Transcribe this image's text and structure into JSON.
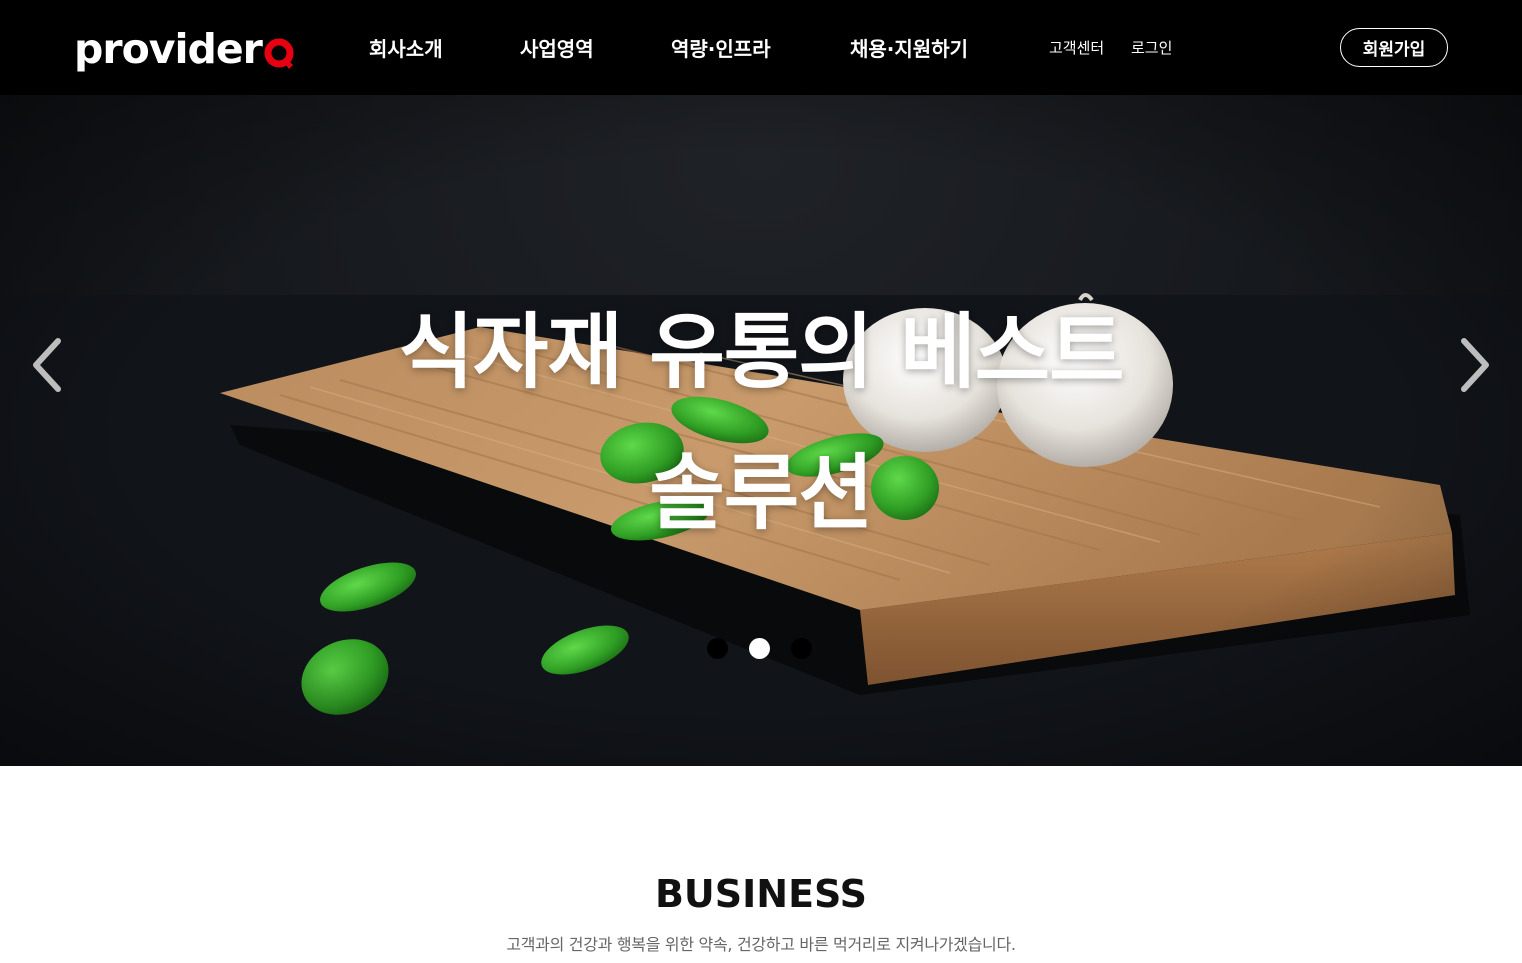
{
  "header": {
    "logo_text": "provider",
    "logo_q_letter": "Q",
    "nav": [
      {
        "label": "회사소개"
      },
      {
        "label": "사업영역"
      },
      {
        "label": "역량·인프라"
      },
      {
        "label": "채용·지원하기"
      }
    ],
    "util": [
      {
        "label": "고객센터"
      },
      {
        "label": "로그인"
      }
    ],
    "signup_label": "회원가입"
  },
  "hero": {
    "title_line1": "식자재 유통의 베스트",
    "title_line2": "솔루션",
    "active_slide": 1,
    "slide_count": 3
  },
  "business": {
    "title": "BUSINESS",
    "subtitle": "고객과의 건강과 행복을 위한 약속, 건강하고 바른 먹거리로 지켜나가겠습니다."
  },
  "colors": {
    "header_bg": "#000000",
    "brand_accent": "#e60012",
    "hero_bg": "#15181c"
  }
}
